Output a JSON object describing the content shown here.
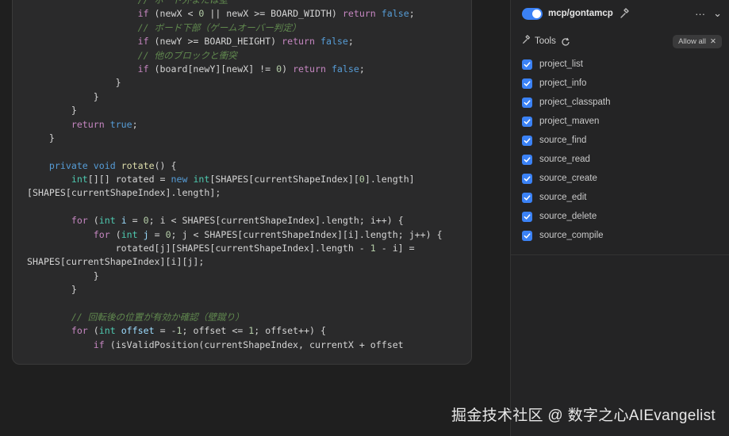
{
  "code": {
    "lines": [
      [
        {
          "c": "cmt",
          "t": "                    // ボード外または壁"
        }
      ],
      [
        {
          "c": "",
          "t": "                    "
        },
        {
          "c": "kw2",
          "t": "if"
        },
        {
          "c": "",
          "t": " (newX < "
        },
        {
          "c": "num",
          "t": "0"
        },
        {
          "c": "",
          "t": " || newX >= BOARD_WIDTH) "
        },
        {
          "c": "kw2",
          "t": "return"
        },
        {
          "c": "",
          "t": " "
        },
        {
          "c": "kw",
          "t": "false"
        },
        {
          "c": "",
          "t": ";"
        }
      ],
      [
        {
          "c": "cmt",
          "t": "                    // ボード下部（ゲームオーバー判定）"
        }
      ],
      [
        {
          "c": "",
          "t": "                    "
        },
        {
          "c": "kw2",
          "t": "if"
        },
        {
          "c": "",
          "t": " (newY >= BOARD_HEIGHT) "
        },
        {
          "c": "kw2",
          "t": "return"
        },
        {
          "c": "",
          "t": " "
        },
        {
          "c": "kw",
          "t": "false"
        },
        {
          "c": "",
          "t": ";"
        }
      ],
      [
        {
          "c": "cmt",
          "t": "                    // 他のブロックと衝突"
        }
      ],
      [
        {
          "c": "",
          "t": "                    "
        },
        {
          "c": "kw2",
          "t": "if"
        },
        {
          "c": "",
          "t": " (board[newY][newX] != "
        },
        {
          "c": "num",
          "t": "0"
        },
        {
          "c": "",
          "t": ") "
        },
        {
          "c": "kw2",
          "t": "return"
        },
        {
          "c": "",
          "t": " "
        },
        {
          "c": "kw",
          "t": "false"
        },
        {
          "c": "",
          "t": ";"
        }
      ],
      [
        {
          "c": "",
          "t": "                }"
        }
      ],
      [
        {
          "c": "",
          "t": "            }"
        }
      ],
      [
        {
          "c": "",
          "t": "        }"
        }
      ],
      [
        {
          "c": "",
          "t": "        "
        },
        {
          "c": "kw2",
          "t": "return"
        },
        {
          "c": "",
          "t": " "
        },
        {
          "c": "kw",
          "t": "true"
        },
        {
          "c": "",
          "t": ";"
        }
      ],
      [
        {
          "c": "",
          "t": "    }"
        }
      ],
      [
        {
          "c": "",
          "t": ""
        }
      ],
      [
        {
          "c": "",
          "t": "    "
        },
        {
          "c": "kw",
          "t": "private"
        },
        {
          "c": "",
          "t": " "
        },
        {
          "c": "kw",
          "t": "void"
        },
        {
          "c": "",
          "t": " "
        },
        {
          "c": "fn",
          "t": "rotate"
        },
        {
          "c": "",
          "t": "() {"
        }
      ],
      [
        {
          "c": "",
          "t": "        "
        },
        {
          "c": "ty",
          "t": "int"
        },
        {
          "c": "",
          "t": "[][] rotated = "
        },
        {
          "c": "kw",
          "t": "new"
        },
        {
          "c": "",
          "t": " "
        },
        {
          "c": "ty",
          "t": "int"
        },
        {
          "c": "",
          "t": "[SHAPES[currentShapeIndex]["
        },
        {
          "c": "num",
          "t": "0"
        },
        {
          "c": "",
          "t": "].length]"
        }
      ],
      [
        {
          "c": "",
          "t": "[SHAPES[currentShapeIndex].length];"
        }
      ],
      [
        {
          "c": "",
          "t": ""
        }
      ],
      [
        {
          "c": "",
          "t": "        "
        },
        {
          "c": "kw2",
          "t": "for"
        },
        {
          "c": "",
          "t": " ("
        },
        {
          "c": "ty",
          "t": "int"
        },
        {
          "c": "",
          "t": " "
        },
        {
          "c": "var",
          "t": "i"
        },
        {
          "c": "",
          "t": " = "
        },
        {
          "c": "num",
          "t": "0"
        },
        {
          "c": "",
          "t": "; i < SHAPES[currentShapeIndex].length; i++) {"
        }
      ],
      [
        {
          "c": "",
          "t": "            "
        },
        {
          "c": "kw2",
          "t": "for"
        },
        {
          "c": "",
          "t": " ("
        },
        {
          "c": "ty",
          "t": "int"
        },
        {
          "c": "",
          "t": " "
        },
        {
          "c": "var",
          "t": "j"
        },
        {
          "c": "",
          "t": " = "
        },
        {
          "c": "num",
          "t": "0"
        },
        {
          "c": "",
          "t": "; j < SHAPES[currentShapeIndex][i].length; j++) {"
        }
      ],
      [
        {
          "c": "",
          "t": "                rotated[j][SHAPES[currentShapeIndex].length - "
        },
        {
          "c": "num",
          "t": "1"
        },
        {
          "c": "",
          "t": " - i] ="
        }
      ],
      [
        {
          "c": "",
          "t": "SHAPES[currentShapeIndex][i][j];"
        }
      ],
      [
        {
          "c": "",
          "t": "            }"
        }
      ],
      [
        {
          "c": "",
          "t": "        }"
        }
      ],
      [
        {
          "c": "",
          "t": ""
        }
      ],
      [
        {
          "c": "cmt",
          "t": "        // 回転後の位置が有効か確認（壁蹴り）"
        }
      ],
      [
        {
          "c": "",
          "t": "        "
        },
        {
          "c": "kw2",
          "t": "for"
        },
        {
          "c": "",
          "t": " ("
        },
        {
          "c": "ty",
          "t": "int"
        },
        {
          "c": "",
          "t": " "
        },
        {
          "c": "var",
          "t": "offset"
        },
        {
          "c": "",
          "t": " = -"
        },
        {
          "c": "num",
          "t": "1"
        },
        {
          "c": "",
          "t": "; offset <= "
        },
        {
          "c": "num",
          "t": "1"
        },
        {
          "c": "",
          "t": "; offset++) {"
        }
      ],
      [
        {
          "c": "",
          "t": "            "
        },
        {
          "c": "kw2",
          "t": "if"
        },
        {
          "c": "",
          "t": " (isValidPosition(currentShapeIndex, currentX + offset"
        }
      ]
    ]
  },
  "panel": {
    "server_name": "mcp/gontamcp",
    "server_enabled": true,
    "more_label": "···",
    "collapse_label": "⌄",
    "tools_label": "Tools",
    "allow_all_label": "Allow all",
    "allow_all_close": "✕",
    "tools": [
      {
        "label": "project_list",
        "checked": true
      },
      {
        "label": "project_info",
        "checked": true
      },
      {
        "label": "project_classpath",
        "checked": true
      },
      {
        "label": "project_maven",
        "checked": true
      },
      {
        "label": "source_find",
        "checked": true
      },
      {
        "label": "source_read",
        "checked": true
      },
      {
        "label": "source_create",
        "checked": true
      },
      {
        "label": "source_edit",
        "checked": true
      },
      {
        "label": "source_delete",
        "checked": true
      },
      {
        "label": "source_compile",
        "checked": true
      }
    ]
  },
  "watermark": "掘金技术社区 @ 数字之心AIEvangelist",
  "colors": {
    "accent": "#3b82f6",
    "background": "#1f1f1f",
    "card": "#2a2a2b"
  }
}
